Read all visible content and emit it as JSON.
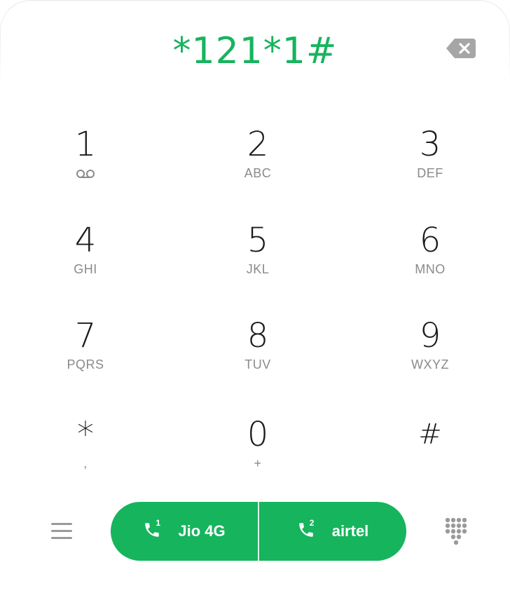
{
  "dialer": {
    "display_number": "*121*1#",
    "keys": [
      {
        "digit": "1",
        "sub": "",
        "sub_icon": "voicemail-icon"
      },
      {
        "digit": "2",
        "sub": "ABC"
      },
      {
        "digit": "3",
        "sub": "DEF"
      },
      {
        "digit": "4",
        "sub": "GHI"
      },
      {
        "digit": "5",
        "sub": "JKL"
      },
      {
        "digit": "6",
        "sub": "MNO"
      },
      {
        "digit": "7",
        "sub": "PQRS"
      },
      {
        "digit": "8",
        "sub": "TUV"
      },
      {
        "digit": "9",
        "sub": "WXYZ"
      },
      {
        "digit": "*",
        "sub": ","
      },
      {
        "digit": "0",
        "sub": "+"
      },
      {
        "digit": "#",
        "sub": ""
      }
    ]
  },
  "call_bar": {
    "sim1": {
      "slot": "1",
      "label": "Jio 4G"
    },
    "sim2": {
      "slot": "2",
      "label": "airtel"
    }
  },
  "icons": {
    "backspace": "backspace-icon",
    "menu": "menu-icon",
    "call": "phone-icon",
    "keypad": "dialpad-icon"
  },
  "colors": {
    "accent": "#16b45d",
    "digit": "#1b1b1b",
    "letters": "#8a8a8a",
    "icon_gray": "#9a9a9a",
    "background": "#ffffff"
  }
}
